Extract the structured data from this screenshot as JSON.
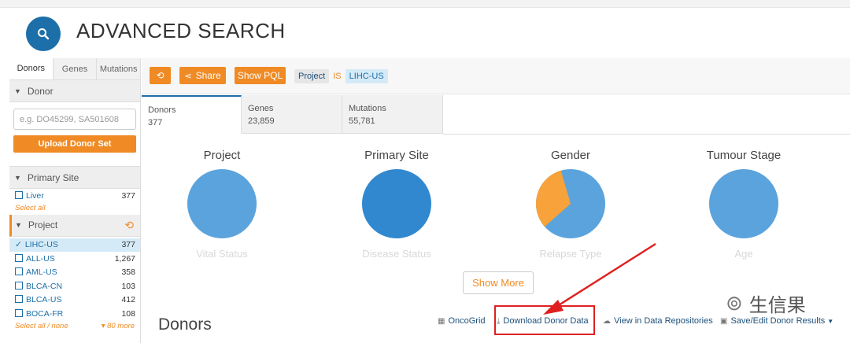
{
  "page": {
    "title": "ADVANCED SEARCH"
  },
  "sidebar": {
    "tabs": [
      "Donors",
      "Genes",
      "Mutations"
    ],
    "donor_facet": {
      "title": "Donor",
      "placeholder": "e.g. DO45299, SA501608",
      "upload_label": "Upload Donor Set"
    },
    "primary_site": {
      "title": "Primary Site",
      "terms": [
        {
          "label": "Liver",
          "count": "377"
        }
      ],
      "select_all": "Select all"
    },
    "project": {
      "title": "Project",
      "terms": [
        {
          "label": "LIHC-US",
          "count": "377",
          "selected": true
        },
        {
          "label": "ALL-US",
          "count": "1,267"
        },
        {
          "label": "AML-US",
          "count": "358"
        },
        {
          "label": "BLCA-CN",
          "count": "103"
        },
        {
          "label": "BLCA-US",
          "count": "412"
        },
        {
          "label": "BOCA-FR",
          "count": "108"
        }
      ],
      "select_all": "Select all / none",
      "more": "▾ 80 more"
    }
  },
  "querybar": {
    "share_label": "Share",
    "pql_label": "Show PQL",
    "query": {
      "field": "Project",
      "op": "IS",
      "value": "LIHC-US"
    }
  },
  "result_tabs": [
    {
      "label": "Donors",
      "count": "377"
    },
    {
      "label": "Genes",
      "count": "23,859"
    },
    {
      "label": "Mutations",
      "count": "55,781"
    }
  ],
  "pies": [
    {
      "title": "Project",
      "below": "Vital Status"
    },
    {
      "title": "Primary Site",
      "below": "Disease Status"
    },
    {
      "title": "Gender",
      "below": "Relapse Type"
    },
    {
      "title": "Tumour Stage",
      "below": "Age"
    }
  ],
  "colors": {
    "accent": "#ef8a24",
    "brand": "#1d6fa9",
    "pie_light": "#5ba3dc",
    "pie_dark": "#3188cf",
    "pie_orange": "#f7a23a",
    "annotation": "#e02020"
  },
  "gender_split": {
    "orange_fraction": 0.32
  },
  "show_more_label": "Show More",
  "section_title": "Donors",
  "actions": {
    "oncogrid": "OncoGrid",
    "download": "Download Donor Data",
    "repos": "View in Data Repositories",
    "save": "Save/Edit Donor Results"
  },
  "watermark": "生信果"
}
